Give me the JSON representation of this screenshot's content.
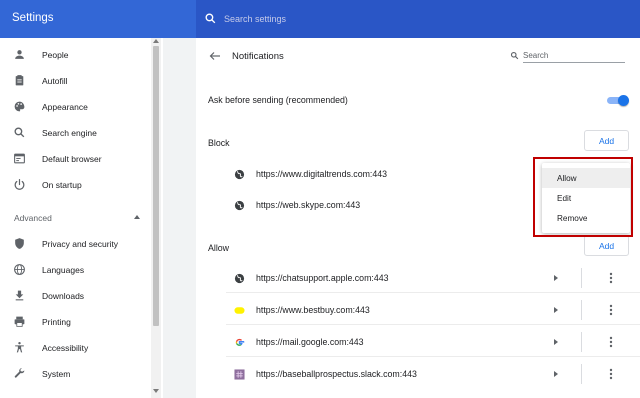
{
  "header": {
    "app_title": "Settings",
    "search_placeholder": "Search settings",
    "icon": "search-icon"
  },
  "sidebar": {
    "items": [
      {
        "label": "People",
        "icon": "person-icon"
      },
      {
        "label": "Autofill",
        "icon": "clipboard-icon"
      },
      {
        "label": "Appearance",
        "icon": "palette-icon"
      },
      {
        "label": "Search engine",
        "icon": "search-icon"
      },
      {
        "label": "Default browser",
        "icon": "browser-icon"
      },
      {
        "label": "On startup",
        "icon": "power-icon"
      }
    ],
    "advanced_label": "Advanced",
    "advanced_items": [
      {
        "label": "Privacy and security",
        "icon": "shield-icon"
      },
      {
        "label": "Languages",
        "icon": "globe-icon"
      },
      {
        "label": "Downloads",
        "icon": "download-icon"
      },
      {
        "label": "Printing",
        "icon": "printer-icon"
      },
      {
        "label": "Accessibility",
        "icon": "accessibility-icon"
      },
      {
        "label": "System",
        "icon": "wrench-icon"
      }
    ]
  },
  "main": {
    "title": "Notifications",
    "search_placeholder": "Search",
    "ask_label": "Ask before sending (recommended)",
    "ask_enabled": true,
    "block": {
      "label": "Block",
      "add_label": "Add",
      "sites": [
        {
          "url": "https://www.digitaltrends.com:443",
          "icon": "globe-icon"
        },
        {
          "url": "https://web.skype.com:443",
          "icon": "globe-icon"
        }
      ]
    },
    "allow": {
      "label": "Allow",
      "add_label": "Add",
      "sites": [
        {
          "url": "https://chatsupport.apple.com:443",
          "icon": "globe-icon"
        },
        {
          "url": "https://www.bestbuy.com:443",
          "icon": "bestbuy-favicon"
        },
        {
          "url": "https://mail.google.com:443",
          "icon": "google-favicon"
        },
        {
          "url": "https://baseballprospectus.slack.com:443",
          "icon": "slack-favicon"
        }
      ]
    },
    "context_menu": {
      "items": [
        "Allow",
        "Edit",
        "Remove"
      ],
      "highlighted": "Allow"
    }
  },
  "colors": {
    "header": "#3367d6",
    "search_bar": "#2a56c6",
    "accent": "#1a73e8",
    "annotation_box": "#c00000"
  }
}
